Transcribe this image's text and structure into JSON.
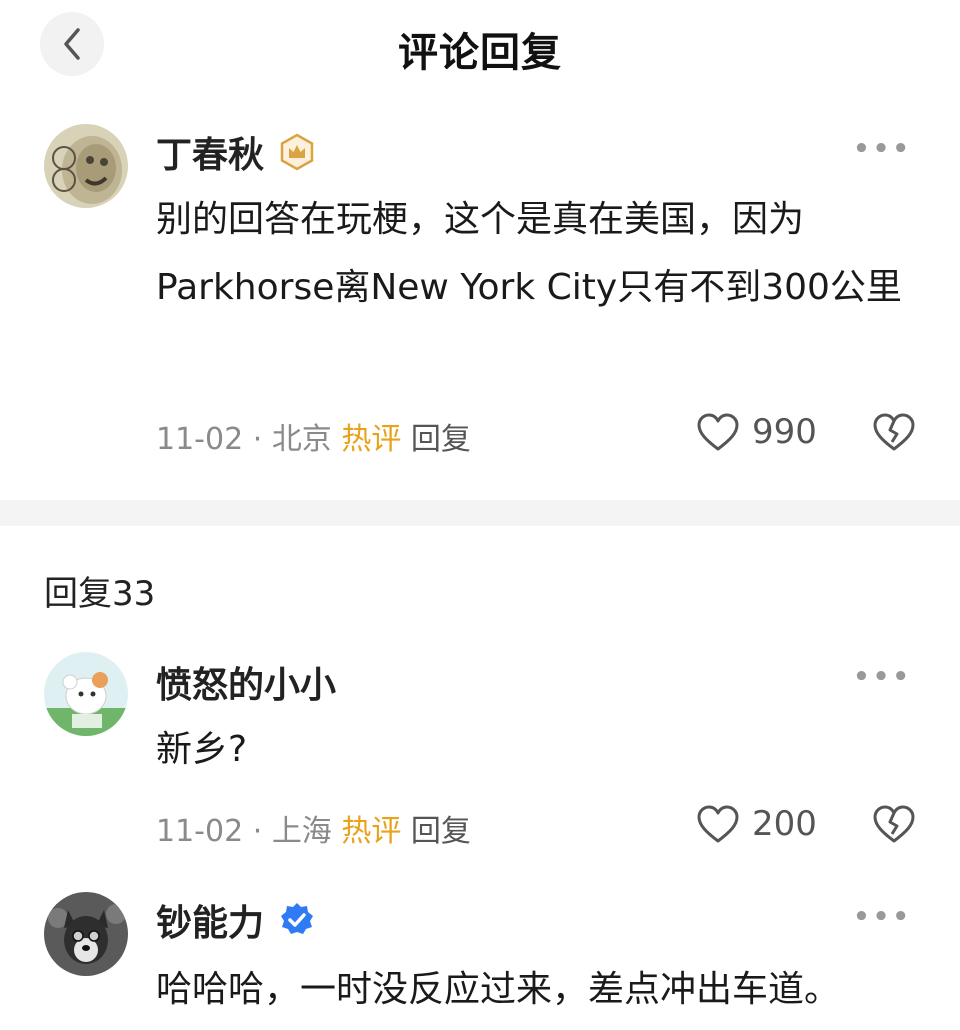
{
  "header": {
    "title": "评论回复"
  },
  "main_comment": {
    "username": "丁春秋",
    "text": "别的回答在玩梗，这个是真在美国，因为Parkhorse离New York City只有不到300公里",
    "date": "11-02",
    "location": "北京",
    "hot_label": "热评",
    "reply_label": "回复",
    "likes": "990"
  },
  "reply_section": {
    "count_label": "回复33"
  },
  "replies": [
    {
      "username": "愤怒的小小",
      "text": "新乡?",
      "date": "11-02",
      "location": "上海",
      "hot_label": "热评",
      "reply_label": "回复",
      "likes": "200"
    },
    {
      "username": "钞能力",
      "text": "哈哈哈，一时没反应过来，差点冲出车道。"
    }
  ],
  "colors": {
    "hot": "#e8a21b",
    "verified": "#2f7bf5",
    "crown_badge": "#d9a441",
    "divider": "#f4f4f4"
  },
  "icons": {
    "back": "chevron-left-icon",
    "more": "more-dots-icon",
    "like": "heart-icon",
    "dislike": "broken-heart-icon",
    "crown_badge": "crown-badge-icon",
    "verified": "verified-check-icon"
  }
}
